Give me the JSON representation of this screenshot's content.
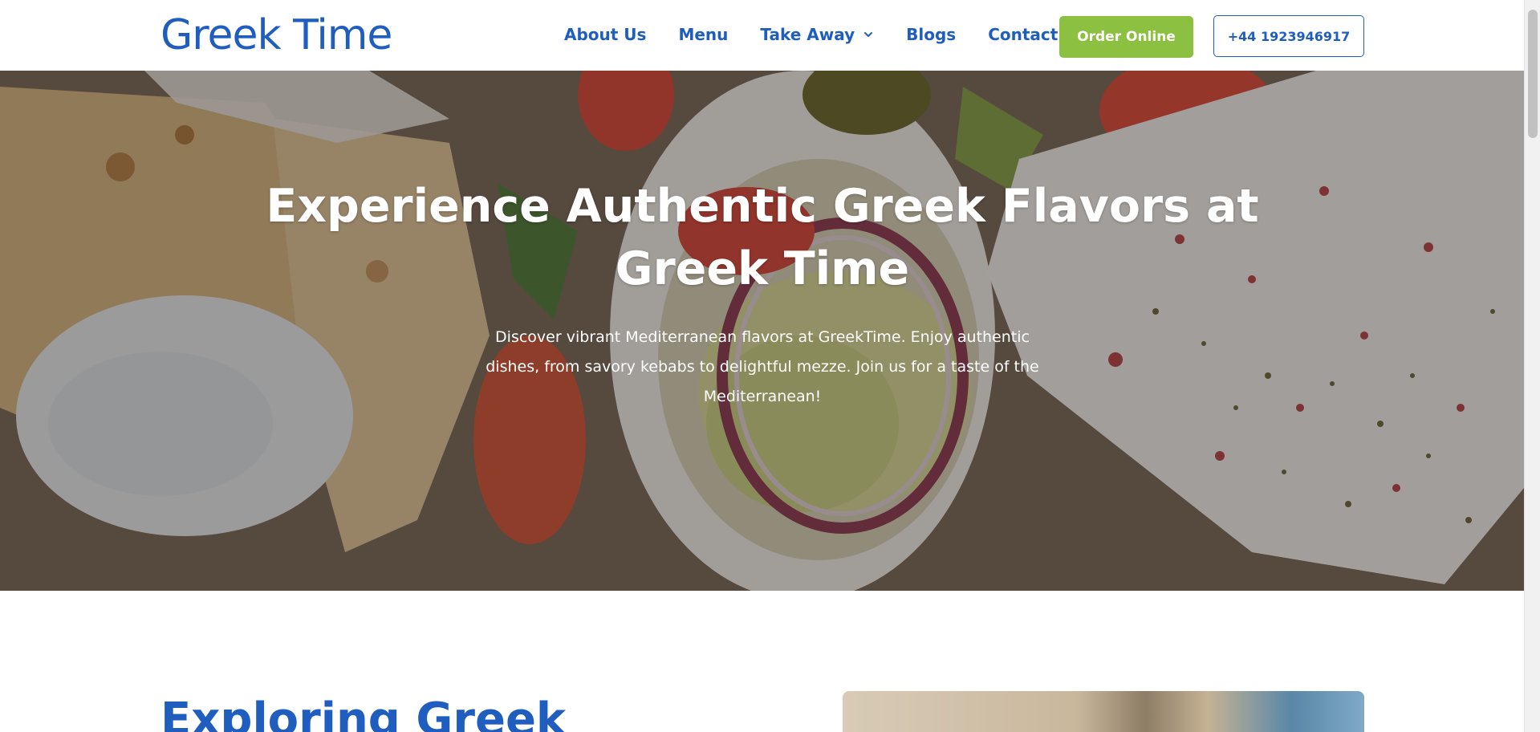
{
  "header": {
    "logo": "Greek Time",
    "nav": [
      {
        "label": "About Us"
      },
      {
        "label": "Menu"
      },
      {
        "label": "Take Away",
        "has_dropdown": true
      },
      {
        "label": "Blogs"
      },
      {
        "label": "Contact"
      }
    ],
    "order_button": "Order Online",
    "phone_button": "+44 1923946917",
    "brand_color": "#1f5dbf",
    "accent_color": "#8bc040"
  },
  "hero": {
    "title": "Experience Authentic Greek Flavors at Greek Time",
    "subtitle": "Discover vibrant Mediterranean flavors at GreekTime. Enjoy authentic dishes, from savory kebabs to delightful mezze. Join us for a taste of the Mediterranean!"
  },
  "section": {
    "heading": "Exploring Greek"
  }
}
